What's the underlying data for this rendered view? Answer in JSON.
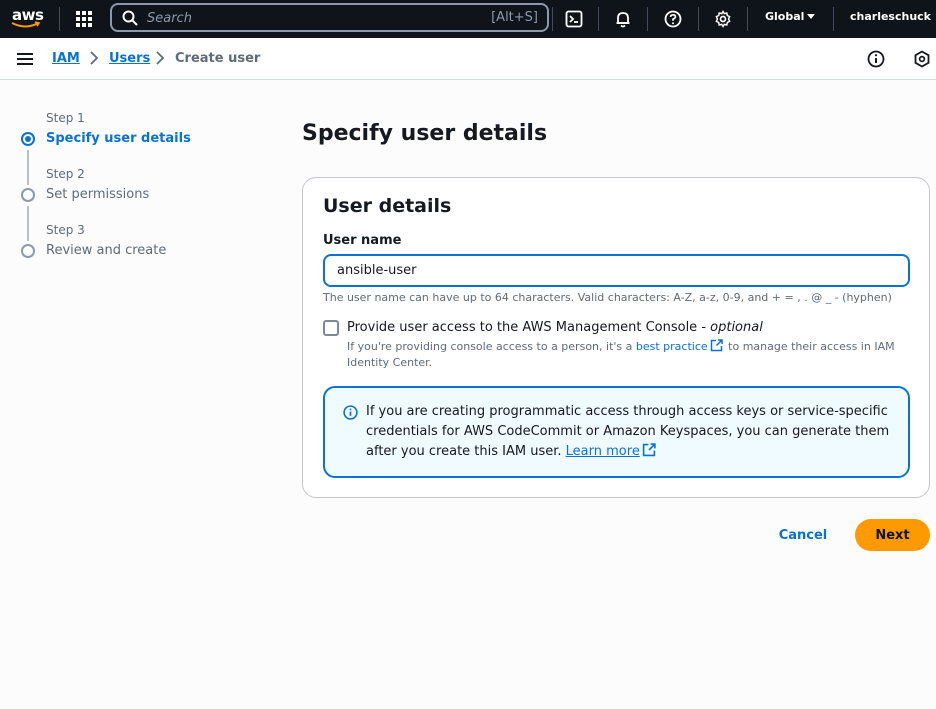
{
  "topnav": {
    "logo_text": "aws",
    "search_placeholder": "Search",
    "search_shortcut": "[Alt+S]",
    "region": "Global",
    "user": "charleschuck",
    "icons": [
      "services-grid-icon",
      "search-icon",
      "cloudshell-icon",
      "bell-icon",
      "help-icon",
      "gear-icon",
      "caret-down-icon"
    ]
  },
  "breadcrumb": {
    "items": [
      "IAM",
      "Users"
    ],
    "current": "Create user"
  },
  "steps": [
    {
      "number": "Step 1",
      "title": "Specify user details",
      "state": "active"
    },
    {
      "number": "Step 2",
      "title": "Set permissions",
      "state": "pending"
    },
    {
      "number": "Step 3",
      "title": "Review and create",
      "state": "pending"
    }
  ],
  "main": {
    "title": "Specify user details",
    "card": {
      "title": "User details",
      "user_name_label": "User name",
      "user_name_value": "ansible-user",
      "user_name_hint": "The user name can have up to 64 characters. Valid characters: A-Z, a-z, 0-9, and + = , . @ _ - (hyphen)",
      "console_access_label": "Provide user access to the AWS Management Console - ",
      "console_access_optional": "optional",
      "console_access_checked": false,
      "console_desc_before": "If you're providing console access to a person, it's a ",
      "console_desc_link": "best practice",
      "console_desc_after": " to manage their access in IAM Identity Center.",
      "alert_text": "If you are creating programmatic access through access keys or service-specific credentials for AWS CodeCommit or Amazon Keyspaces, you can generate them after you create this IAM user. ",
      "alert_link": "Learn more"
    }
  },
  "actions": {
    "cancel": "Cancel",
    "next": "Next"
  },
  "colors": {
    "topbar": "#0f141a",
    "accent": "#0972d3",
    "primary_button": "#ff9900",
    "alert_bg": "#f0fbff"
  }
}
